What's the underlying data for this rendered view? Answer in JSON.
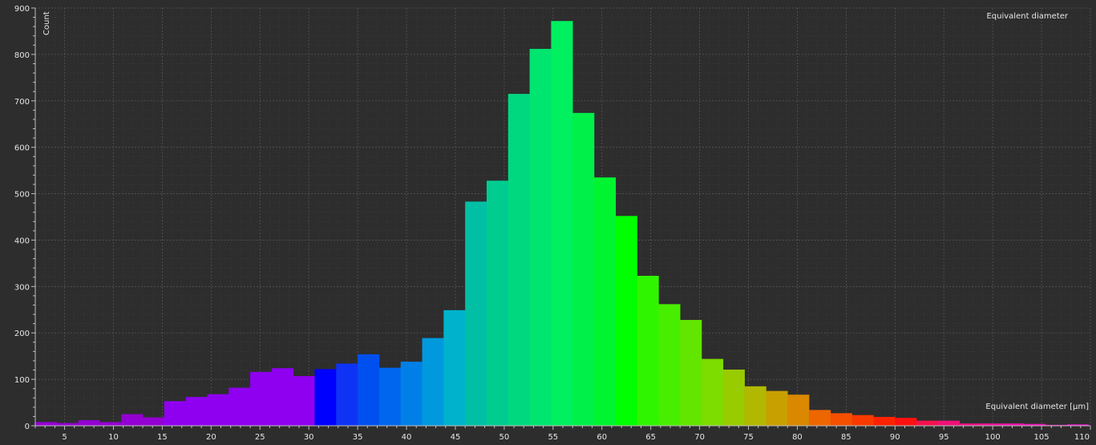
{
  "chart_data": {
    "type": "bar",
    "title": "Equivalent diameter",
    "xlabel": "Equivalent diameter [µm]",
    "ylabel": "Count",
    "xlim": [
      2,
      110
    ],
    "ylim": [
      0,
      900
    ],
    "x_ticks": [
      5,
      10,
      15,
      20,
      25,
      30,
      35,
      40,
      45,
      50,
      55,
      60,
      65,
      70,
      75,
      80,
      85,
      90,
      95,
      100,
      105,
      110
    ],
    "y_ticks": [
      0,
      100,
      200,
      300,
      400,
      500,
      600,
      700,
      800,
      900
    ],
    "grid": true,
    "bin_width": 2.2,
    "bins": [
      {
        "x": 2.0,
        "value": 8,
        "color": "#9400d3"
      },
      {
        "x": 4.2,
        "value": 6,
        "color": "#9400d3"
      },
      {
        "x": 6.4,
        "value": 12,
        "color": "#9400d3"
      },
      {
        "x": 8.6,
        "value": 8,
        "color": "#9400d3"
      },
      {
        "x": 10.8,
        "value": 25,
        "color": "#9400d3"
      },
      {
        "x": 13.0,
        "value": 18,
        "color": "#9400d3"
      },
      {
        "x": 15.2,
        "value": 53,
        "color": "#8f00f0"
      },
      {
        "x": 17.4,
        "value": 62,
        "color": "#8f00f0"
      },
      {
        "x": 19.6,
        "value": 68,
        "color": "#8f00f0"
      },
      {
        "x": 21.8,
        "value": 82,
        "color": "#8f00f0"
      },
      {
        "x": 24.0,
        "value": 116,
        "color": "#8f00f0"
      },
      {
        "x": 26.2,
        "value": 124,
        "color": "#8f00f0"
      },
      {
        "x": 28.4,
        "value": 107,
        "color": "#8f00f0"
      },
      {
        "x": 30.6,
        "value": 122,
        "color": "#0000ff"
      },
      {
        "x": 32.8,
        "value": 134,
        "color": "#0f33f5"
      },
      {
        "x": 35.0,
        "value": 154,
        "color": "#0050f0"
      },
      {
        "x": 37.2,
        "value": 125,
        "color": "#0066ee"
      },
      {
        "x": 39.4,
        "value": 138,
        "color": "#0080e6"
      },
      {
        "x": 41.6,
        "value": 189,
        "color": "#0099dd"
      },
      {
        "x": 43.8,
        "value": 249,
        "color": "#00b2cc"
      },
      {
        "x": 46.0,
        "value": 483,
        "color": "#00bfa5"
      },
      {
        "x": 48.2,
        "value": 528,
        "color": "#00cc90"
      },
      {
        "x": 50.4,
        "value": 715,
        "color": "#00d880"
      },
      {
        "x": 52.6,
        "value": 812,
        "color": "#00e470"
      },
      {
        "x": 54.8,
        "value": 872,
        "color": "#00f060"
      },
      {
        "x": 57.0,
        "value": 674,
        "color": "#00f04a"
      },
      {
        "x": 59.2,
        "value": 535,
        "color": "#00f530"
      },
      {
        "x": 61.4,
        "value": 452,
        "color": "#00ff00"
      },
      {
        "x": 63.6,
        "value": 323,
        "color": "#30f500"
      },
      {
        "x": 65.8,
        "value": 262,
        "color": "#48ee00"
      },
      {
        "x": 68.0,
        "value": 228,
        "color": "#62e600"
      },
      {
        "x": 70.2,
        "value": 144,
        "color": "#7ddc00"
      },
      {
        "x": 72.4,
        "value": 121,
        "color": "#99cc00"
      },
      {
        "x": 74.6,
        "value": 85,
        "color": "#b2b800"
      },
      {
        "x": 76.8,
        "value": 75,
        "color": "#c8a000"
      },
      {
        "x": 79.0,
        "value": 67,
        "color": "#d98800"
      },
      {
        "x": 81.2,
        "value": 34,
        "color": "#ee6600"
      },
      {
        "x": 83.4,
        "value": 27,
        "color": "#f54f00"
      },
      {
        "x": 85.6,
        "value": 23,
        "color": "#fb3a00"
      },
      {
        "x": 87.8,
        "value": 19,
        "color": "#ff2200"
      },
      {
        "x": 90.0,
        "value": 17,
        "color": "#ff1010"
      },
      {
        "x": 92.2,
        "value": 11,
        "color": "#f5104f"
      },
      {
        "x": 94.4,
        "value": 11,
        "color": "#ee1177"
      },
      {
        "x": 96.6,
        "value": 5,
        "color": "#ee1188"
      },
      {
        "x": 98.8,
        "value": 5,
        "color": "#ee1199"
      },
      {
        "x": 101.0,
        "value": 5,
        "color": "#ee11aa"
      },
      {
        "x": 103.2,
        "value": 4,
        "color": "#ee11bb"
      },
      {
        "x": 105.4,
        "value": 2,
        "color": "#ee11bb"
      },
      {
        "x": 107.6,
        "value": 3,
        "color": "#ee11cc"
      }
    ]
  },
  "colors": {
    "background": "#2d2d2d",
    "axis": "#bfbfbf",
    "grid": "#5a5a5a",
    "text": "#e6e6e6"
  }
}
